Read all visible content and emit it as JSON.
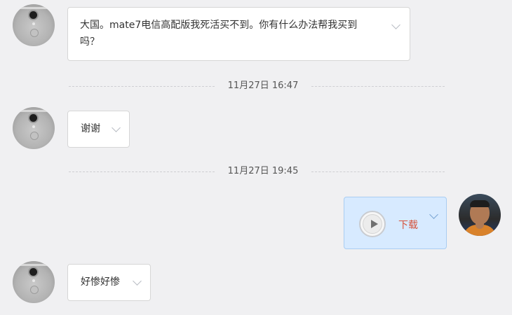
{
  "messages": [
    {
      "text_line1": "大国。mate7电信高配版我死活买不到。你有什么办法帮我买到",
      "text_line2": "吗？"
    },
    {
      "text": "谢谢"
    },
    {
      "download_label": "下载"
    },
    {
      "text": "好惨好惨"
    }
  ],
  "timestamps": [
    "11月27日 16:47",
    "11月27日 19:45"
  ],
  "icons": {
    "menu_chevron": "chevron-down-icon",
    "play": "play-icon"
  },
  "colors": {
    "background": "#f0f0f2",
    "incoming_bubble": "#ffffff",
    "outgoing_bubble": "#d7eaff",
    "download_link": "#d6523a"
  }
}
